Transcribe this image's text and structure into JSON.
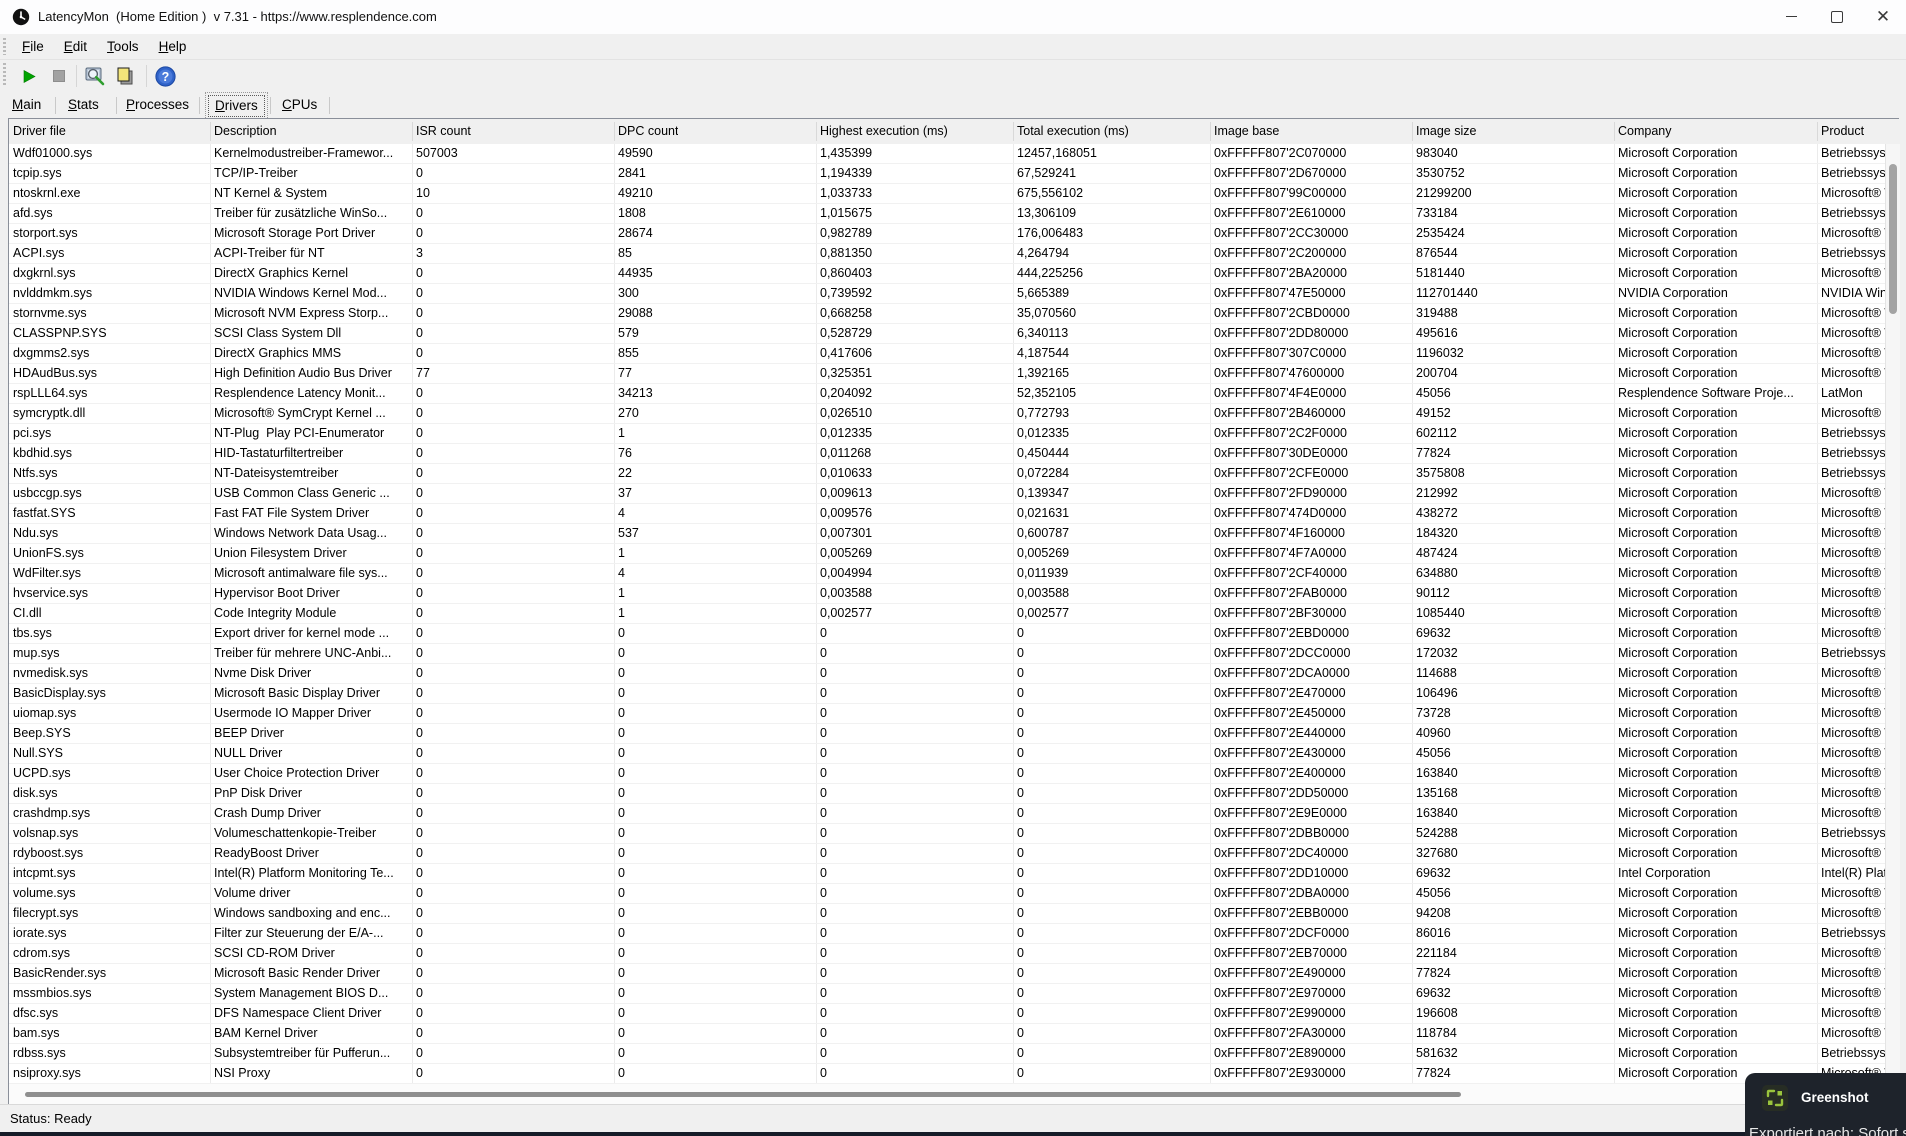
{
  "window": {
    "title": "LatencyMon  (Home Edition )  v 7.31 - https://www.resplendence.com"
  },
  "menu": {
    "items": [
      "File",
      "Edit",
      "Tools",
      "Help"
    ]
  },
  "toolbar": {
    "icons": [
      "start-monitor-icon",
      "stop-monitor-icon",
      "report-wizard-icon",
      "copy-icon",
      "help-icon"
    ],
    "colors": {
      "start_green": "#00a400",
      "stop_gray": "#9e9e9e",
      "copy_yellow": "#f3e57a",
      "help_blue": "#2f62c8"
    }
  },
  "tabs": {
    "items": [
      "Main",
      "Stats",
      "Processes",
      "Drivers",
      "CPUs"
    ],
    "selected": "Drivers"
  },
  "table": {
    "columns": [
      "Driver file",
      "Description",
      "ISR count",
      "DPC count",
      "Highest execution (ms)",
      "Total execution (ms)",
      "Image base",
      "Image size",
      "Company",
      "Product"
    ],
    "rows": [
      [
        "Wdf01000.sys",
        "Kernelmodustreiber-Framewor...",
        "507003",
        "49590",
        "1,435399",
        "12457,168051",
        "0xFFFFF807'2C070000",
        "983040",
        "Microsoft Corporation",
        "Betriebssyst"
      ],
      [
        "tcpip.sys",
        "TCP/IP-Treiber",
        "0",
        "2841",
        "1,194339",
        "67,529241",
        "0xFFFFF807'2D670000",
        "3530752",
        "Microsoft Corporation",
        "Betriebssyst"
      ],
      [
        "ntoskrnl.exe",
        "NT Kernel & System",
        "10",
        "49210",
        "1,033733",
        "675,556102",
        "0xFFFFF807'99C00000",
        "21299200",
        "Microsoft Corporation",
        "Microsoft® W"
      ],
      [
        "afd.sys",
        "Treiber für zusätzliche WinSo...",
        "0",
        "1808",
        "1,015675",
        "13,306109",
        "0xFFFFF807'2E610000",
        "733184",
        "Microsoft Corporation",
        "Betriebssyst"
      ],
      [
        "storport.sys",
        "Microsoft Storage Port Driver",
        "0",
        "28674",
        "0,982789",
        "176,006483",
        "0xFFFFF807'2CC30000",
        "2535424",
        "Microsoft Corporation",
        "Microsoft® W"
      ],
      [
        "ACPI.sys",
        "ACPI-Treiber für NT",
        "3",
        "85",
        "0,881350",
        "4,264794",
        "0xFFFFF807'2C200000",
        "876544",
        "Microsoft Corporation",
        "Betriebssyst"
      ],
      [
        "dxgkrnl.sys",
        "DirectX Graphics Kernel",
        "0",
        "44935",
        "0,860403",
        "444,225256",
        "0xFFFFF807'2BA20000",
        "5181440",
        "Microsoft Corporation",
        "Microsoft® W"
      ],
      [
        "nvlddmkm.sys",
        "NVIDIA Windows Kernel Mod...",
        "0",
        "300",
        "0,739592",
        "5,665389",
        "0xFFFFF807'47E50000",
        "112701440",
        "NVIDIA Corporation",
        "NVIDIA Wind"
      ],
      [
        "stornvme.sys",
        "Microsoft NVM Express Storp...",
        "0",
        "29088",
        "0,668258",
        "35,070560",
        "0xFFFFF807'2CBD0000",
        "319488",
        "Microsoft Corporation",
        "Microsoft® W"
      ],
      [
        "CLASSPNP.SYS",
        "SCSI Class System Dll",
        "0",
        "579",
        "0,528729",
        "6,340113",
        "0xFFFFF807'2DD80000",
        "495616",
        "Microsoft Corporation",
        "Microsoft® W"
      ],
      [
        "dxgmms2.sys",
        "DirectX Graphics MMS",
        "0",
        "855",
        "0,417606",
        "4,187544",
        "0xFFFFF807'307C0000",
        "1196032",
        "Microsoft Corporation",
        "Microsoft® W"
      ],
      [
        "HDAudBus.sys",
        "High Definition Audio Bus Driver",
        "77",
        "77",
        "0,325351",
        "1,392165",
        "0xFFFFF807'47600000",
        "200704",
        "Microsoft Corporation",
        "Microsoft® W"
      ],
      [
        "rspLLL64.sys",
        "Resplendence Latency Monit...",
        "0",
        "34213",
        "0,204092",
        "52,352105",
        "0xFFFFF807'4F4E0000",
        "45056",
        "Resplendence Software Proje...",
        "LatMon"
      ],
      [
        "symcryptk.dll",
        "Microsoft® SymCrypt Kernel ...",
        "0",
        "270",
        "0,026510",
        "0,772793",
        "0xFFFFF807'2B460000",
        "49152",
        "Microsoft Corporation",
        "Microsoft® S"
      ],
      [
        "pci.sys",
        "NT-Plug  Play PCI-Enumerator",
        "0",
        "1",
        "0,012335",
        "0,012335",
        "0xFFFFF807'2C2F0000",
        "602112",
        "Microsoft Corporation",
        "Betriebssyst"
      ],
      [
        "kbdhid.sys",
        "HID-Tastaturfiltertreiber",
        "0",
        "76",
        "0,011268",
        "0,450444",
        "0xFFFFF807'30DE0000",
        "77824",
        "Microsoft Corporation",
        "Betriebssyst"
      ],
      [
        "Ntfs.sys",
        "NT-Dateisystemtreiber",
        "0",
        "22",
        "0,010633",
        "0,072284",
        "0xFFFFF807'2CFE0000",
        "3575808",
        "Microsoft Corporation",
        "Betriebssyst"
      ],
      [
        "usbccgp.sys",
        "USB Common Class Generic ...",
        "0",
        "37",
        "0,009613",
        "0,139347",
        "0xFFFFF807'2FD90000",
        "212992",
        "Microsoft Corporation",
        "Microsoft® W"
      ],
      [
        "fastfat.SYS",
        "Fast FAT File System Driver",
        "0",
        "4",
        "0,009576",
        "0,021631",
        "0xFFFFF807'474D0000",
        "438272",
        "Microsoft Corporation",
        "Microsoft® W"
      ],
      [
        "Ndu.sys",
        "Windows Network Data Usag...",
        "0",
        "537",
        "0,007301",
        "0,600787",
        "0xFFFFF807'4F160000",
        "184320",
        "Microsoft Corporation",
        "Microsoft® W"
      ],
      [
        "UnionFS.sys",
        "Union Filesystem Driver",
        "0",
        "1",
        "0,005269",
        "0,005269",
        "0xFFFFF807'4F7A0000",
        "487424",
        "Microsoft Corporation",
        "Microsoft® W"
      ],
      [
        "WdFilter.sys",
        "Microsoft antimalware file sys...",
        "0",
        "4",
        "0,004994",
        "0,011939",
        "0xFFFFF807'2CF40000",
        "634880",
        "Microsoft Corporation",
        "Microsoft® W"
      ],
      [
        "hvservice.sys",
        "Hypervisor Boot Driver",
        "0",
        "1",
        "0,003588",
        "0,003588",
        "0xFFFFF807'2FAB0000",
        "90112",
        "Microsoft Corporation",
        "Microsoft® W"
      ],
      [
        "CI.dll",
        "Code Integrity Module",
        "0",
        "1",
        "0,002577",
        "0,002577",
        "0xFFFFF807'2BF30000",
        "1085440",
        "Microsoft Corporation",
        "Microsoft® W"
      ],
      [
        "tbs.sys",
        "Export driver for kernel mode ...",
        "0",
        "0",
        "0",
        "0",
        "0xFFFFF807'2EBD0000",
        "69632",
        "Microsoft Corporation",
        "Microsoft® W"
      ],
      [
        "mup.sys",
        "Treiber für mehrere UNC-Anbi...",
        "0",
        "0",
        "0",
        "0",
        "0xFFFFF807'2DCC0000",
        "172032",
        "Microsoft Corporation",
        "Betriebssyst"
      ],
      [
        "nvmedisk.sys",
        "Nvme Disk Driver",
        "0",
        "0",
        "0",
        "0",
        "0xFFFFF807'2DCA0000",
        "114688",
        "Microsoft Corporation",
        "Microsoft® W"
      ],
      [
        "BasicDisplay.sys",
        "Microsoft Basic Display Driver",
        "0",
        "0",
        "0",
        "0",
        "0xFFFFF807'2E470000",
        "106496",
        "Microsoft Corporation",
        "Microsoft® W"
      ],
      [
        "uiomap.sys",
        "Usermode IO Mapper Driver",
        "0",
        "0",
        "0",
        "0",
        "0xFFFFF807'2E450000",
        "73728",
        "Microsoft Corporation",
        "Microsoft® W"
      ],
      [
        "Beep.SYS",
        "BEEP Driver",
        "0",
        "0",
        "0",
        "0",
        "0xFFFFF807'2E440000",
        "40960",
        "Microsoft Corporation",
        "Microsoft® W"
      ],
      [
        "Null.SYS",
        "NULL Driver",
        "0",
        "0",
        "0",
        "0",
        "0xFFFFF807'2E430000",
        "45056",
        "Microsoft Corporation",
        "Microsoft® W"
      ],
      [
        "UCPD.sys",
        "User Choice Protection Driver",
        "0",
        "0",
        "0",
        "0",
        "0xFFFFF807'2E400000",
        "163840",
        "Microsoft Corporation",
        "Microsoft® W"
      ],
      [
        "disk.sys",
        "PnP Disk Driver",
        "0",
        "0",
        "0",
        "0",
        "0xFFFFF807'2DD50000",
        "135168",
        "Microsoft Corporation",
        "Microsoft® W"
      ],
      [
        "crashdmp.sys",
        "Crash Dump Driver",
        "0",
        "0",
        "0",
        "0",
        "0xFFFFF807'2E9E0000",
        "163840",
        "Microsoft Corporation",
        "Microsoft® W"
      ],
      [
        "volsnap.sys",
        "Volumeschattenkopie-Treiber",
        "0",
        "0",
        "0",
        "0",
        "0xFFFFF807'2DBB0000",
        "524288",
        "Microsoft Corporation",
        "Betriebssyst"
      ],
      [
        "rdyboost.sys",
        "ReadyBoost Driver",
        "0",
        "0",
        "0",
        "0",
        "0xFFFFF807'2DC40000",
        "327680",
        "Microsoft Corporation",
        "Microsoft® W"
      ],
      [
        "intcpmt.sys",
        "Intel(R) Platform Monitoring Te...",
        "0",
        "0",
        "0",
        "0",
        "0xFFFFF807'2DD10000",
        "69632",
        "Intel Corporation",
        "Intel(R) Platf"
      ],
      [
        "volume.sys",
        "Volume driver",
        "0",
        "0",
        "0",
        "0",
        "0xFFFFF807'2DBA0000",
        "45056",
        "Microsoft Corporation",
        "Microsoft® W"
      ],
      [
        "filecrypt.sys",
        "Windows sandboxing and enc...",
        "0",
        "0",
        "0",
        "0",
        "0xFFFFF807'2EBB0000",
        "94208",
        "Microsoft Corporation",
        "Microsoft® W"
      ],
      [
        "iorate.sys",
        "Filter zur Steuerung der E/A-...",
        "0",
        "0",
        "0",
        "0",
        "0xFFFFF807'2DCF0000",
        "86016",
        "Microsoft Corporation",
        "Betriebssyst"
      ],
      [
        "cdrom.sys",
        "SCSI CD-ROM Driver",
        "0",
        "0",
        "0",
        "0",
        "0xFFFFF807'2EB70000",
        "221184",
        "Microsoft Corporation",
        "Microsoft® W"
      ],
      [
        "BasicRender.sys",
        "Microsoft Basic Render Driver",
        "0",
        "0",
        "0",
        "0",
        "0xFFFFF807'2E490000",
        "77824",
        "Microsoft Corporation",
        "Microsoft® W"
      ],
      [
        "mssmbios.sys",
        "System Management BIOS D...",
        "0",
        "0",
        "0",
        "0",
        "0xFFFFF807'2E970000",
        "69632",
        "Microsoft Corporation",
        "Microsoft® W"
      ],
      [
        "dfsc.sys",
        "DFS Namespace Client Driver",
        "0",
        "0",
        "0",
        "0",
        "0xFFFFF807'2E990000",
        "196608",
        "Microsoft Corporation",
        "Microsoft® W"
      ],
      [
        "bam.sys",
        "BAM Kernel Driver",
        "0",
        "0",
        "0",
        "0",
        "0xFFFFF807'2FA30000",
        "118784",
        "Microsoft Corporation",
        "Microsoft® W"
      ],
      [
        "rdbss.sys",
        "Subsystemtreiber für Pufferun...",
        "0",
        "0",
        "0",
        "0",
        "0xFFFFF807'2E890000",
        "581632",
        "Microsoft Corporation",
        "Betriebssyst"
      ],
      [
        "nsiproxy.sys",
        "NSI Proxy",
        "0",
        "0",
        "0",
        "0",
        "0xFFFFF807'2E930000",
        "77824",
        "Microsoft Corporation",
        "Microsoft® W"
      ]
    ]
  },
  "statusbar": {
    "text": "Status: Ready"
  },
  "toast": {
    "app_name": "Greenshot",
    "message": "Exportiert nach: Sofort s",
    "background": "#1e232b",
    "accent_green": "#9ac43d"
  }
}
